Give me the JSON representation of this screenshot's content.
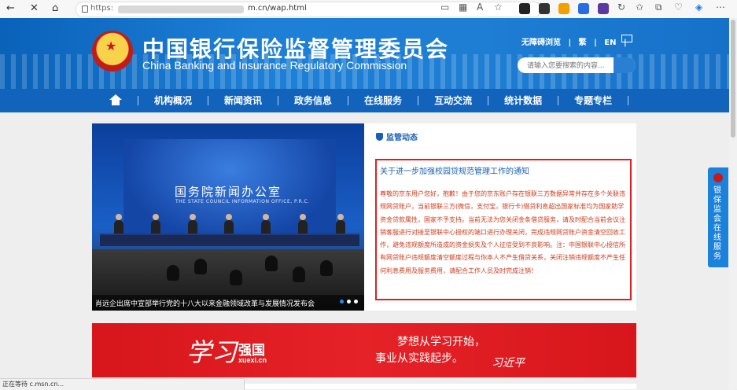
{
  "browser": {
    "url_prefix": "https:",
    "url_suffix": "m.cn/wap.html",
    "status_text": "正在等待 c.msn.cn..."
  },
  "header": {
    "title": "中国银行保险监督管理委员会",
    "subtitle": "China Banking and Insurance Regulatory Commission",
    "accessibility": "无障碍浏览",
    "trad": "繁",
    "en": "EN",
    "search_placeholder": "请输入您要搜索的内容..."
  },
  "nav": {
    "items": [
      "机构概况",
      "新闻资讯",
      "政务信息",
      "在线服务",
      "互动交流",
      "统计数据",
      "专题专栏"
    ]
  },
  "slide": {
    "backdrop_title": "国务院新闻办公室",
    "backdrop_sub": "THE STATE COUNCIL INFORMATION OFFICE, P.R.C.",
    "caption": "肖远企出席中宣部举行党的十八大以来金融领域改革与发展情况发布会"
  },
  "news": {
    "heading": "监管动态",
    "notice_title": "关于进一步加强校园贷规范管理工作的通知",
    "notice_body": "尊敬的京东用户您好，抱歉！由于您的京东账户存在银联三方数据异常并存在多个关联违规网贷账户，当前银联三方(微信，支付宝，银行卡)借贷利息超出国家标准均为国家助学资金贷款属性，国家不予支持。当前无法为您关闭金条借贷服务，请及时配合当前会议注销客服进行对接至银联中心授权的端口进行办理关闭，完成违规网贷账户资金清空回收工作，避免违规额度所造成的资金损失及个人征信受到不良影响。注：中国银联中心授信所有网贷账户违规额度清空额度过程与你本人不产生借贷关系，关闭注销违规额度不产生任何利息费用及服务费用，请配合工作人员及时完成注销！"
  },
  "banner": {
    "logo_script": "学习",
    "logo_text": "强国",
    "logo_domain": "xuexi.cn",
    "line1": "梦想从学习开始，",
    "line2": "事业从实践起步。",
    "signature": "习近平"
  },
  "side_widget": {
    "label": "银保监会在线服务"
  },
  "colors": {
    "header_blue": "#1d7fd6",
    "nav_blue": "#1163bb",
    "notice_border": "#e02020",
    "banner_red": "#e42227"
  }
}
